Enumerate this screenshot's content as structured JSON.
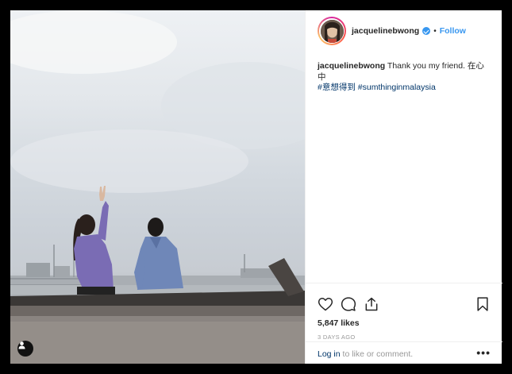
{
  "post": {
    "username": "jacquelinebwong",
    "separator": "•",
    "follow_label": "Follow",
    "caption_user": "jacquelinebwong",
    "caption_text": "Thank you my friend. 在心中",
    "hashtag_1": "#意想得到",
    "hashtag_2": "#sumthinginmalaysia",
    "likes": "5,847 likes",
    "time_ago": "3 DAYS AGO",
    "login_link": "Log in",
    "login_rest": " to like or comment.",
    "more_label": "•••"
  },
  "icons": {
    "like": "heart-icon",
    "comment": "comment-icon",
    "share": "share-icon",
    "save": "bookmark-icon",
    "verified": "verified-badge-icon",
    "tagged": "user-tag-icon"
  },
  "colors": {
    "accent": "#3897f0",
    "hashtag": "#003569",
    "muted": "#999999"
  }
}
